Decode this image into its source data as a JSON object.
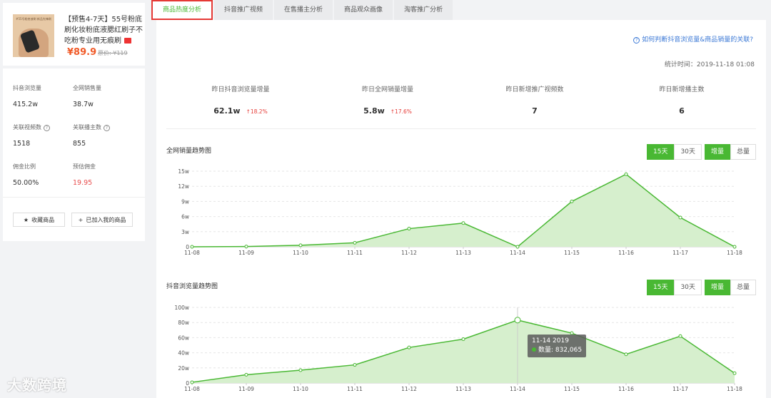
{
  "product": {
    "thumb_text": "#55号粉底液刷 新品先锋刷",
    "title": "【预售4-7天】55号粉底刷化妆粉底液腮红刷子不吃粉专业用无痕刷",
    "price": "¥89.9",
    "original_price": "原价: ¥119"
  },
  "stats": {
    "views_label": "抖音浏览量",
    "views_value": "415.2w",
    "sales_label": "全网销售量",
    "sales_value": "38.7w",
    "videos_label": "关联视频数",
    "videos_value": "1518",
    "anchors_label": "关联播主数",
    "anchors_value": "855",
    "commission_ratio_label": "佣金比例",
    "commission_ratio_value": "50.00%",
    "est_commission_label": "预估佣金",
    "est_commission_value": "19.95",
    "fav_button": "收藏商品",
    "added_button": "已加入我的商品"
  },
  "tabs": [
    "商品热度分析",
    "抖音推广视频",
    "在售播主分析",
    "商品观众画像",
    "淘客推广分析"
  ],
  "help_link": "如何判断抖音浏览量&商品销量的关联?",
  "stat_time": "统计时间：2019-11-18 01:08",
  "kpis": [
    {
      "label": "昨日抖音浏览量增量",
      "value": "62.1w",
      "change": "↑18.2%"
    },
    {
      "label": "昨日全网销量增量",
      "value": "5.8w",
      "change": "↑17.6%"
    },
    {
      "label": "昨日新增推广视频数",
      "value": "7",
      "change": ""
    },
    {
      "label": "昨日新增播主数",
      "value": "6",
      "change": ""
    }
  ],
  "controls": {
    "d15": "15天",
    "d30": "30天",
    "inc": "增量",
    "total": "总量"
  },
  "colors": {
    "accent": "#49b833",
    "fill": "#d6efcd",
    "red": "#e53935"
  },
  "tooltip": {
    "date": "11-14 2019",
    "text": "数量: 832,065"
  },
  "watermark": "大数跨境",
  "chart_data": [
    {
      "type": "area",
      "title": "全网销量趋势图",
      "x": [
        "11-08",
        "11-09",
        "11-10",
        "11-11",
        "11-12",
        "11-13",
        "11-14",
        "11-15",
        "11-16",
        "11-17",
        "11-18"
      ],
      "values": [
        0,
        0.05,
        0.3,
        0.8,
        3.6,
        4.7,
        0,
        9.0,
        14.4,
        5.8,
        0
      ],
      "yticks": [
        "0",
        "3w",
        "6w",
        "9w",
        "12w",
        "15w"
      ],
      "ylim": [
        0,
        15
      ],
      "grid": true
    },
    {
      "type": "area",
      "title": "抖音浏览量趋势图",
      "x": [
        "11-08",
        "11-09",
        "11-10",
        "11-11",
        "11-12",
        "11-13",
        "11-14",
        "11-15",
        "11-16",
        "11-17",
        "11-18"
      ],
      "values": [
        1,
        11,
        17,
        24,
        47,
        58,
        83.2,
        66,
        38,
        62,
        13
      ],
      "yticks": [
        "0",
        "20w",
        "40w",
        "60w",
        "80w",
        "100w"
      ],
      "ylim": [
        0,
        100
      ],
      "grid": true
    }
  ]
}
